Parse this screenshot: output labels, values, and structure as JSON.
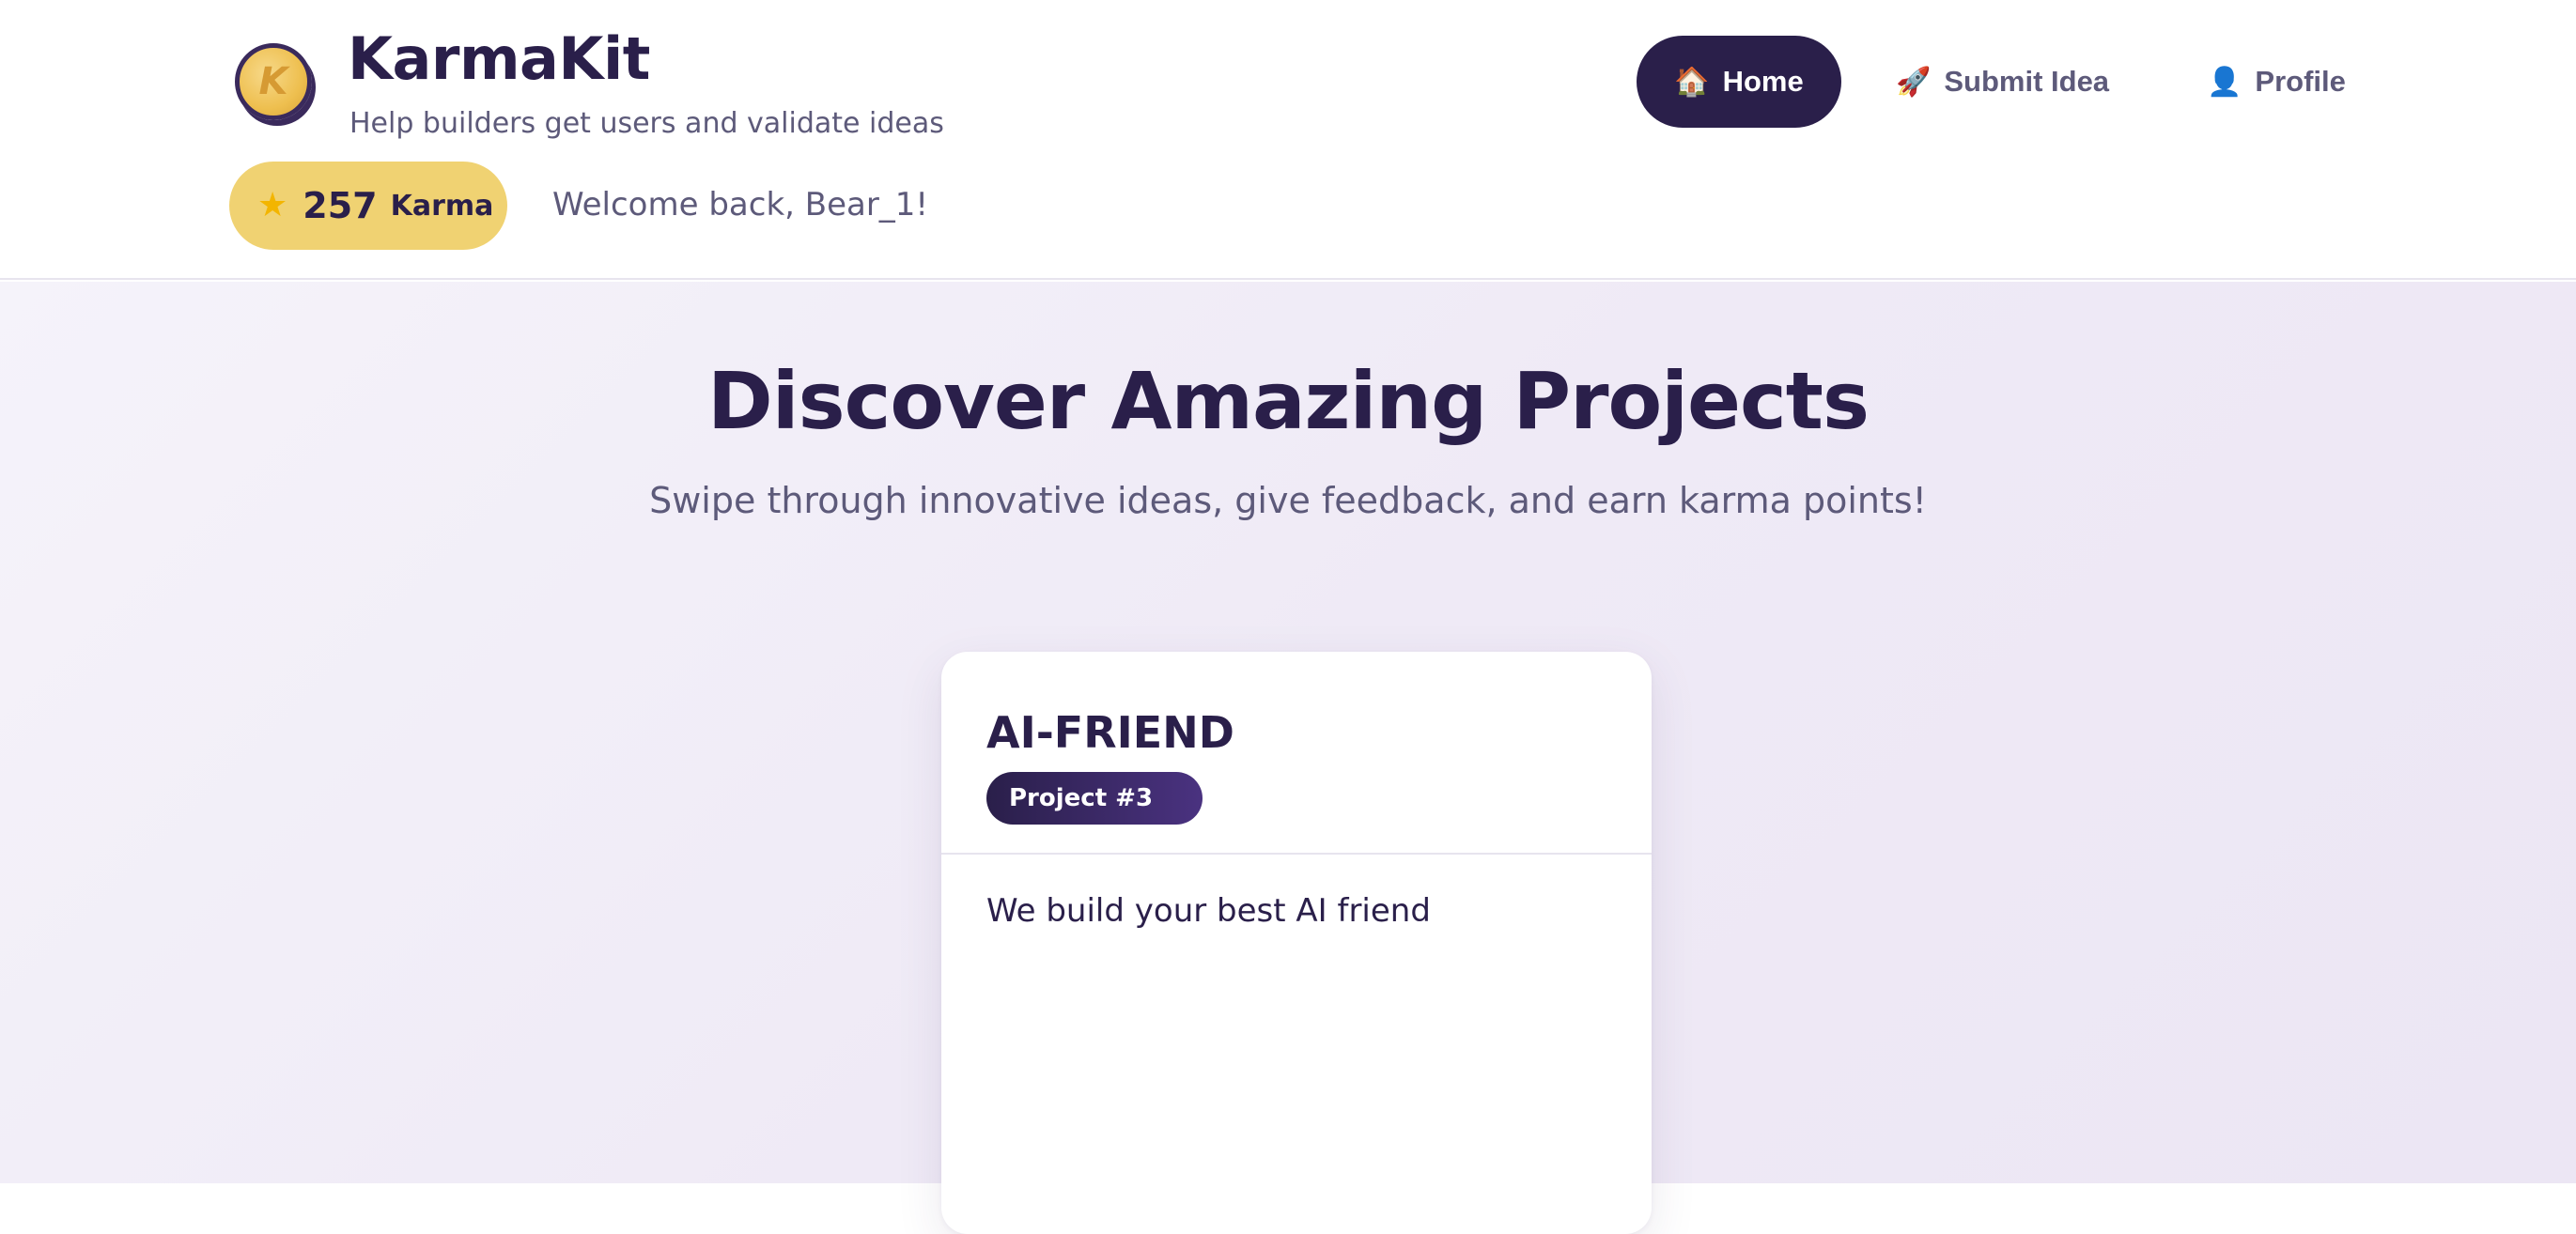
{
  "header": {
    "logo_letter": "K",
    "brand_title": "KarmaKit",
    "tagline": "Help builders get users and validate ideas",
    "karma": {
      "icon": "star-icon",
      "count": "257",
      "label": "Karma"
    },
    "welcome": "Welcome back, Bear_1!"
  },
  "nav": {
    "items": [
      {
        "label": "Home",
        "icon": "house-icon",
        "glyph": "🏠",
        "active": true
      },
      {
        "label": "Submit Idea",
        "icon": "rocket-icon",
        "glyph": "🚀",
        "active": false
      },
      {
        "label": "Profile",
        "icon": "user-icon",
        "glyph": "👤",
        "active": false
      }
    ]
  },
  "hero": {
    "title": "Discover Amazing Projects",
    "subtitle": "Swipe through innovative ideas, give feedback, and earn karma points!"
  },
  "card": {
    "title": "AI-FRIEND",
    "badge": "Project #3",
    "description": "We build your best AI friend"
  },
  "colors": {
    "primary": "#2a1f4a",
    "accent_gold": "#f0d272",
    "muted_text": "#5d5a7a",
    "background": "#f1edf7"
  }
}
